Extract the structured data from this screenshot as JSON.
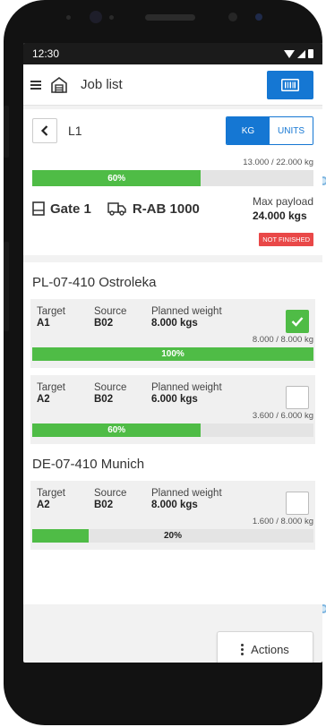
{
  "status_bar": {
    "time": "12:30"
  },
  "app_bar": {
    "title": "Job list"
  },
  "header": {
    "location": "L1",
    "unit_toggle": {
      "kg_label": "KG",
      "units_label": "UNITS",
      "selected": "KG"
    },
    "summary": {
      "weight_text": "13.000 / 22.000 kg",
      "progress_label": "60%",
      "progress_fraction": 0.6
    },
    "gate": "Gate 1",
    "truck": "R-AB 1000",
    "max_payload_label": "Max payload",
    "max_payload_value": "24.000 kgs",
    "status": "NOT FINISHED"
  },
  "labels": {
    "target": "Target",
    "source": "Source",
    "planned_weight": "Planned weight"
  },
  "groups": [
    {
      "title": "PL-07-410 Ostroleka",
      "items": [
        {
          "target": "A1",
          "source": "B02",
          "planned": "8.000 kgs",
          "checked": true,
          "weight_text": "8.000 / 8.000 kg",
          "progress_label": "100%",
          "progress_fraction": 1.0
        },
        {
          "target": "A2",
          "source": "B02",
          "planned": "6.000 kgs",
          "checked": false,
          "weight_text": "3.600 / 6.000 kg",
          "progress_label": "60%",
          "progress_fraction": 0.6
        }
      ]
    },
    {
      "title": "DE-07-410 Munich",
      "items": [
        {
          "target": "A2",
          "source": "B02",
          "planned": "8.000 kgs",
          "checked": false,
          "weight_text": "1.600 / 8.000 kg",
          "progress_label": "20%",
          "progress_fraction": 0.2
        }
      ]
    }
  ],
  "actions": {
    "label": "Actions"
  },
  "colors": {
    "primary": "#1577d3",
    "success": "#4fbc46",
    "danger": "#e94848"
  }
}
